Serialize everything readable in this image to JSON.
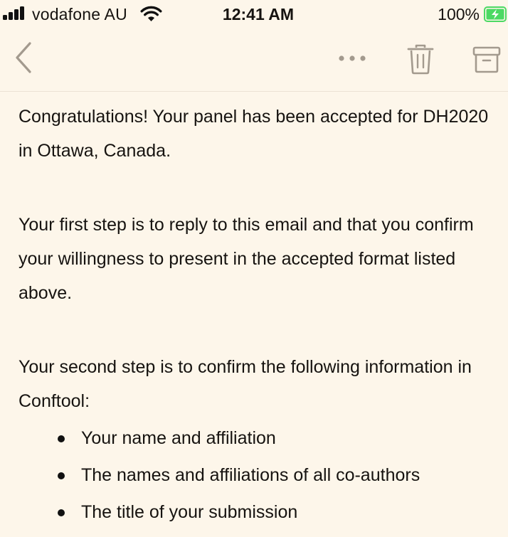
{
  "status_bar": {
    "carrier": "vodafone AU",
    "time": "12:41 AM",
    "battery_percent": "100%"
  },
  "toolbar": {
    "icons": [
      "back-chevron-icon",
      "more-dots-icon",
      "trash-icon",
      "archive-icon"
    ]
  },
  "email": {
    "paragraphs": [
      "Congratulations! Your panel has been accepted for DH2020 in Ottawa, Canada.",
      "Your first step is to reply to this email and that you confirm your willingness to present in the accepted format listed above.",
      "Your second step is to confirm the following information in Conftool:"
    ],
    "bullets": [
      "Your name and affiliation",
      "The names and affiliations of all co-authors",
      "The title of your submission"
    ]
  },
  "colors": {
    "background": "#fdf6ea",
    "text": "#161310",
    "icon": "#a39a8e",
    "battery_fill": "#4cd964"
  }
}
